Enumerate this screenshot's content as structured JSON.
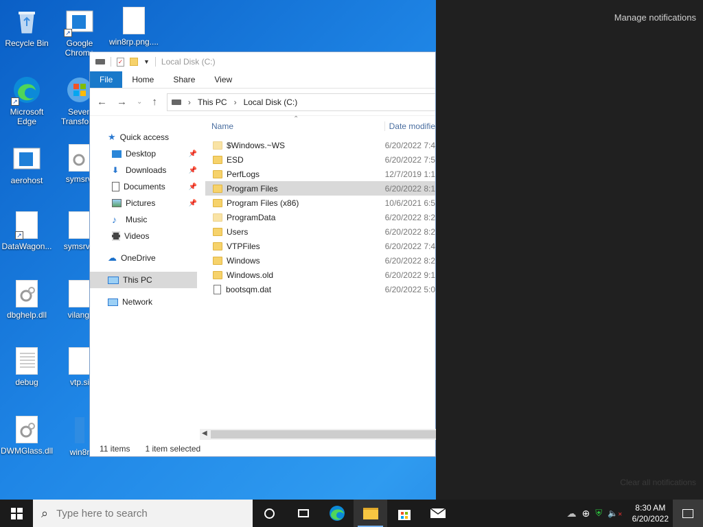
{
  "desktop": {
    "icons": [
      {
        "label": "Recycle Bin"
      },
      {
        "label": "Google Chrome"
      },
      {
        "label": "win8rp.png...."
      },
      {
        "label": "Microsoft Edge"
      },
      {
        "label": "Seven Transform"
      },
      {
        "label": "aerohost"
      },
      {
        "label": "symsrv."
      },
      {
        "label": "DataWagon..."
      },
      {
        "label": "symsrv.y"
      },
      {
        "label": "dbghelp.dll"
      },
      {
        "label": "vilang."
      },
      {
        "label": "debug"
      },
      {
        "label": "vtp.si"
      },
      {
        "label": "DWMGlass.dll"
      },
      {
        "label": "win8r"
      }
    ]
  },
  "explorer": {
    "title": "Local Disk (C:)",
    "ribbon_tabs": [
      "File",
      "Home",
      "Share",
      "View"
    ],
    "breadcrumb": [
      "This PC",
      "Local Disk (C:)"
    ],
    "nav": {
      "quick_access": "Quick access",
      "desktop": "Desktop",
      "downloads": "Downloads",
      "documents": "Documents",
      "pictures": "Pictures",
      "music": "Music",
      "videos": "Videos",
      "onedrive": "OneDrive",
      "this_pc": "This PC",
      "network": "Network"
    },
    "columns": {
      "name": "Name",
      "date": "Date modifie"
    },
    "files": [
      {
        "name": "$Windows.~WS",
        "date": "6/20/2022 7:4"
      },
      {
        "name": "ESD",
        "date": "6/20/2022 7:5"
      },
      {
        "name": "PerfLogs",
        "date": "12/7/2019 1:1"
      },
      {
        "name": "Program Files",
        "date": "6/20/2022 8:1"
      },
      {
        "name": "Program Files (x86)",
        "date": "10/6/2021 6:5"
      },
      {
        "name": "ProgramData",
        "date": "6/20/2022 8:2"
      },
      {
        "name": "Users",
        "date": "6/20/2022 8:2"
      },
      {
        "name": "VTPFiles",
        "date": "6/20/2022 7:4"
      },
      {
        "name": "Windows",
        "date": "6/20/2022 8:2"
      },
      {
        "name": "Windows.old",
        "date": "6/20/2022 9:1"
      },
      {
        "name": "bootsqm.dat",
        "date": "6/20/2022 5:0"
      }
    ],
    "status": {
      "items": "11 items",
      "selected": "1 item selected"
    }
  },
  "action_center": {
    "manage": "Manage notifications",
    "clear": "Clear all notifications"
  },
  "taskbar": {
    "search_placeholder": "Type here to search",
    "time": "8:30 AM",
    "date": "6/20/2022"
  }
}
